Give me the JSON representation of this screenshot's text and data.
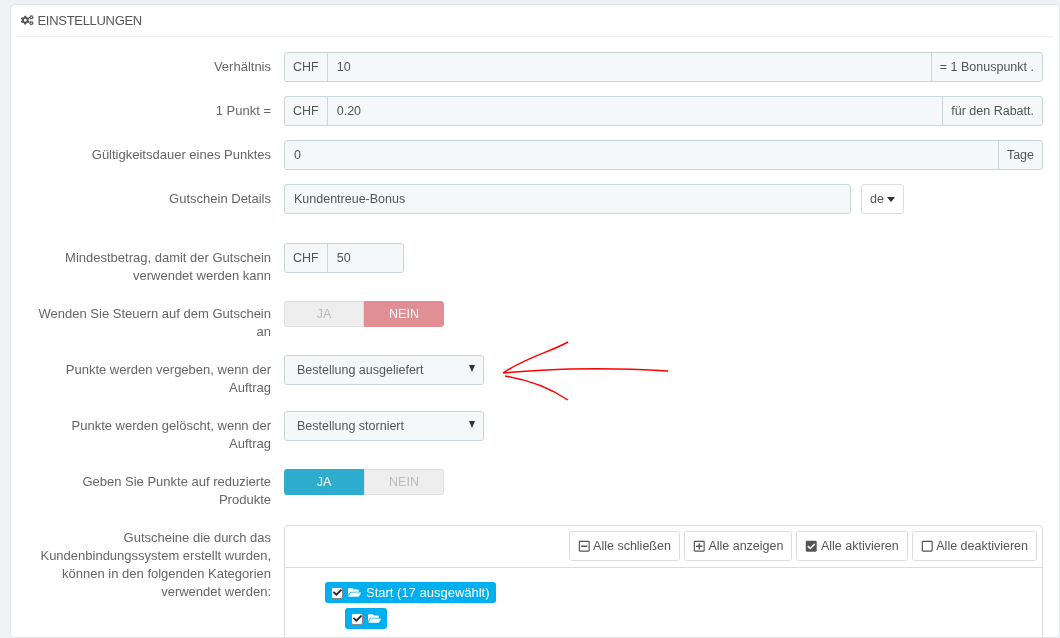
{
  "panel": {
    "title": "EINSTELLUNGEN"
  },
  "rows": [
    {
      "kind": "input_group",
      "label": "Verhältnis",
      "prefix": "CHF",
      "value": "10",
      "suffix": "= 1 Bonuspunkt ."
    },
    {
      "kind": "input_group",
      "label": "1 Punkt =",
      "prefix": "CHF",
      "value": "0.20",
      "suffix": "für den Rabatt."
    },
    {
      "kind": "input_group",
      "label": "Gültigkeitsdauer eines Punktes",
      "value": "0",
      "suffix": "Tage"
    },
    {
      "kind": "lang_input",
      "label": "Gutschein Details",
      "value": "Kundentreue-Bonus",
      "language": "de"
    },
    {
      "kind": "small_input",
      "label": "Mindestbetrag, damit der Gutschein verwendet werden kann",
      "prefix": "CHF",
      "value": "50"
    },
    {
      "kind": "switch",
      "label": "Wenden Sie Steuern auf dem Gutschein an",
      "options": [
        {
          "label": "JA",
          "selected": false
        },
        {
          "label": "NEIN",
          "selected": true
        }
      ]
    },
    {
      "kind": "select",
      "label": "Punkte werden vergeben, wenn der Auftrag",
      "value": "Bestellung ausgeliefert",
      "annotated": true
    },
    {
      "kind": "select",
      "label": "Punkte werden gelöscht, wenn der Auftrag",
      "value": "Bestellung storniert"
    },
    {
      "kind": "switch",
      "label": "Geben Sie Punkte auf reduzierte Produkte",
      "options": [
        {
          "label": "JA",
          "selected": true
        },
        {
          "label": "NEIN",
          "selected": false
        }
      ]
    },
    {
      "kind": "tree",
      "label": "Gutscheine die durch das Kundenbindungssystem erstellt wurden, können in den folgenden Kategorien verwendet werden:",
      "buttons": [
        {
          "kind": "collapse",
          "label": "Alle schließen"
        },
        {
          "kind": "expand",
          "label": "Alle anzeigen"
        },
        {
          "kind": "check",
          "label": "Alle aktivieren"
        },
        {
          "kind": "uncheck",
          "label": "Alle deaktivieren"
        }
      ],
      "items": [
        {
          "label": "Start (17 ausgewählt)",
          "checked": true,
          "children": [
            {
              "checked": true
            }
          ]
        }
      ]
    }
  ]
}
